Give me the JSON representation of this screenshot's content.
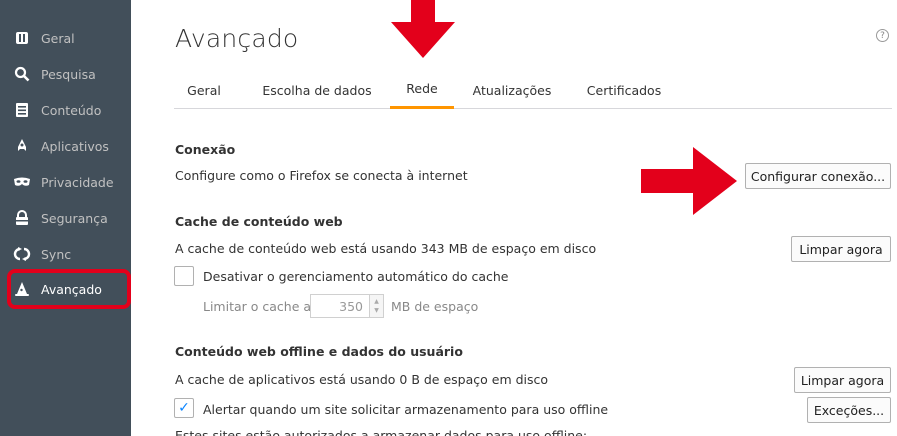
{
  "sidebar": {
    "items": [
      {
        "label": "Geral",
        "icon": "general-icon"
      },
      {
        "label": "Pesquisa",
        "icon": "search-icon"
      },
      {
        "label": "Conteúdo",
        "icon": "document-icon"
      },
      {
        "label": "Aplicativos",
        "icon": "rocket-icon"
      },
      {
        "label": "Privacidade",
        "icon": "mask-icon"
      },
      {
        "label": "Segurança",
        "icon": "lock-icon"
      },
      {
        "label": "Sync",
        "icon": "sync-icon"
      },
      {
        "label": "Avançado",
        "icon": "wizard-hat-icon"
      }
    ]
  },
  "page": {
    "title": "Avançado",
    "help": "?"
  },
  "tabs": [
    {
      "label": "Geral"
    },
    {
      "label": "Escolha de dados"
    },
    {
      "label": "Rede"
    },
    {
      "label": "Atualizações"
    },
    {
      "label": "Certificados"
    }
  ],
  "conexao": {
    "title": "Conexão",
    "desc": "Configure como o Firefox se conecta à internet",
    "button": "Configurar conexão..."
  },
  "cache": {
    "title": "Cache de conteúdo web",
    "desc": "A cache de conteúdo web está usando 343 MB de espaço em disco",
    "clear_button": "Limpar agora",
    "disable_label": "Desativar o gerenciamento automático do cache",
    "limit_label": "Limitar o cache a",
    "limit_value": "350",
    "limit_unit": "MB de espaço"
  },
  "offline": {
    "title": "Conteúdo web offline e dados do usuário",
    "desc": "A cache de aplicativos está usando 0 B de espaço em disco",
    "clear_button": "Limpar agora",
    "alert_label": "Alertar quando um site solicitar armazenamento para uso offline",
    "exceptions_button": "Exceções...",
    "sites_label": "Estes sites estão autorizados a armazenar dados para uso offline:"
  },
  "colors": {
    "sidebar": "#424f5a",
    "accent": "#ff9500",
    "highlight": "#e3001b"
  }
}
